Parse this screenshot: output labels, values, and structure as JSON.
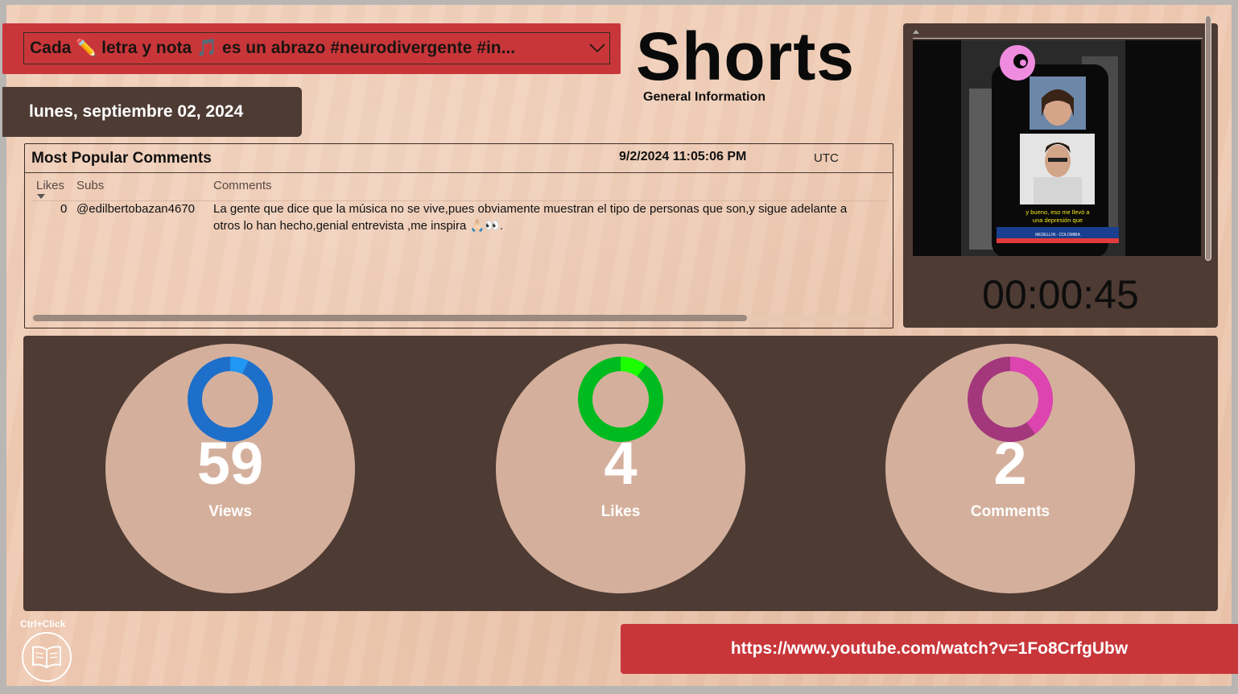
{
  "slicer": {
    "selected_value": "Cada ✏️ letra y nota 🎵 es un abrazo #neurodivergente #in..."
  },
  "date": "lunes, septiembre 02, 2024",
  "header": {
    "title": "Shorts",
    "subtitle": "General Information"
  },
  "comments_table": {
    "title": "Most Popular Comments",
    "timestamp": "9/2/2024 11:05:06 PM",
    "timezone": "UTC",
    "columns": [
      "Likes",
      "Subs",
      "Comments"
    ],
    "rows": [
      {
        "likes": "0",
        "subs": "@edilbertobazan4670",
        "comment_line1": "La gente que dice que la música no se vive,pues obviamente muestran el tipo de personas que son,y sigue adelante a",
        "comment_line2": "otros lo han hecho,genial entrevista ,me inspira 🙏🏻👀."
      }
    ]
  },
  "video": {
    "caption": "y bueno, eso me llevó a una depresión que",
    "ticker": "MEDELLIN - COLOMBIA",
    "elapsed": "00:00:45"
  },
  "kpis": [
    {
      "label": "Views",
      "value": "59",
      "ring_color": "#1e6fc9",
      "accent_color": "#2196f3",
      "accent_fraction": 0.07
    },
    {
      "label": "Likes",
      "value": "4",
      "ring_color": "#00bb1f",
      "accent_color": "#1bff00",
      "accent_fraction": 0.1
    },
    {
      "label": "Comments",
      "value": "2",
      "ring_color": "#a3377c",
      "accent_color": "#dd44b0",
      "accent_fraction": 0.4
    }
  ],
  "footer": {
    "ctrl_hint": "Ctrl+Click",
    "url": "https://www.youtube.com/watch?v=1Fo8CrfgUbw"
  },
  "colors": {
    "background": "#efcab2",
    "panel_dark": "#4e3b33",
    "accent_red": "#c8363a",
    "kpi_circle": "#d4b09c"
  }
}
